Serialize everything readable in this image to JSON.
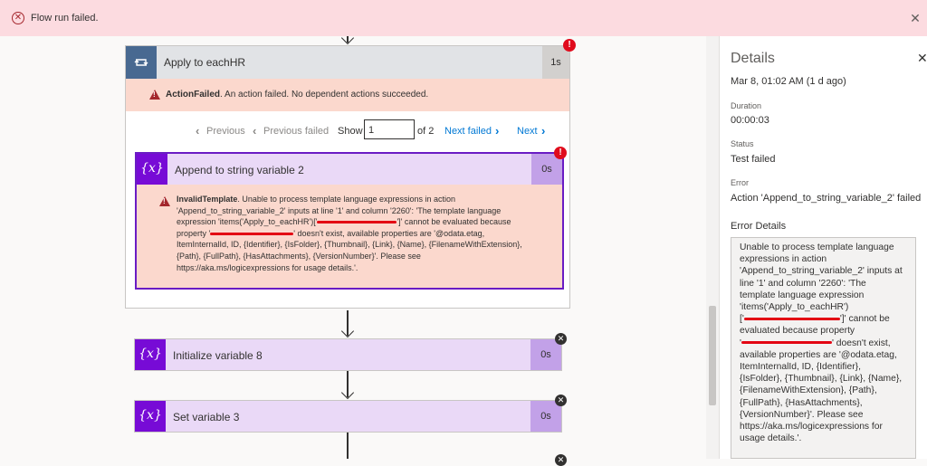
{
  "banner": {
    "message": "Flow run failed.",
    "close_icon": "close-icon"
  },
  "loop": {
    "title": "Apply to eachHR",
    "duration": "1s",
    "error_bold": "ActionFailed",
    "error_text": ". An action failed. No dependent actions succeeded."
  },
  "pager": {
    "previous": "Previous",
    "previous_failed": "Previous failed",
    "show_label": "Show",
    "page_value": "1",
    "of_label": "of 2",
    "next_failed": "Next failed",
    "next": "Next"
  },
  "inner_action": {
    "icon_text": "{x}",
    "title": "Append to string variable 2",
    "duration": "0s",
    "error_bold": "InvalidTemplate",
    "error_line1": ". Unable to process template language expressions in action",
    "error_line2": "'Append_to_string_variable_2' inputs at line '1' and column '2260': 'The template language",
    "error_line3a": "expression 'items('Apply_to_eachHR')['",
    "error_line3b": "']' cannot be evaluated because",
    "error_line4a": "property '",
    "error_line4b": "' doesn't exist, available properties are '@odata.etag,",
    "error_line5": "ItemInternalId, ID, {Identifier}, {IsFolder}, {Thumbnail}, {Link}, {Name}, {FilenameWithExtension},",
    "error_line6": "{Path}, {FullPath}, {HasAttachments}, {VersionNumber}'. Please see",
    "error_line7": "https://aka.ms/logicexpressions for usage details.'."
  },
  "steps": [
    {
      "icon_text": "{x}",
      "title": "Initialize variable 8",
      "duration": "0s"
    },
    {
      "icon_text": "{x}",
      "title": "Set variable 3",
      "duration": "0s"
    }
  ],
  "details": {
    "heading": "Details",
    "timestamp": "Mar 8, 01:02 AM (1 d ago)",
    "duration_label": "Duration",
    "duration_value": "00:00:03",
    "status_label": "Status",
    "status_value": "Test failed",
    "error_label": "Error",
    "error_value": "Action 'Append_to_string_variable_2' failed",
    "error_details_label": "Error Details",
    "error_details_lines": [
      "Unable to process template language",
      "expressions in action",
      "'Append_to_string_variable_2' inputs at",
      "line '1' and column '2260': 'The",
      "template language expression",
      "'items('Apply_to_eachHR')",
      "['",
      "']' cannot be",
      "evaluated because property",
      "'",
      "' doesn't exist,",
      "available properties are '@odata.etag,",
      "ItemInternalId, ID, {Identifier},",
      "{IsFolder}, {Thumbnail}, {Link}, {Name},",
      "{FilenameWithExtension}, {Path},",
      "{FullPath}, {HasAttachments},",
      "{VersionNumber}'. Please see",
      "https://aka.ms/logicexpressions for",
      "usage details.'."
    ]
  },
  "colors": {
    "error_red": "#a4262c",
    "variable_purple": "#770bd6",
    "link_blue": "#0078d4",
    "banner_pink": "#fcdbe0"
  }
}
